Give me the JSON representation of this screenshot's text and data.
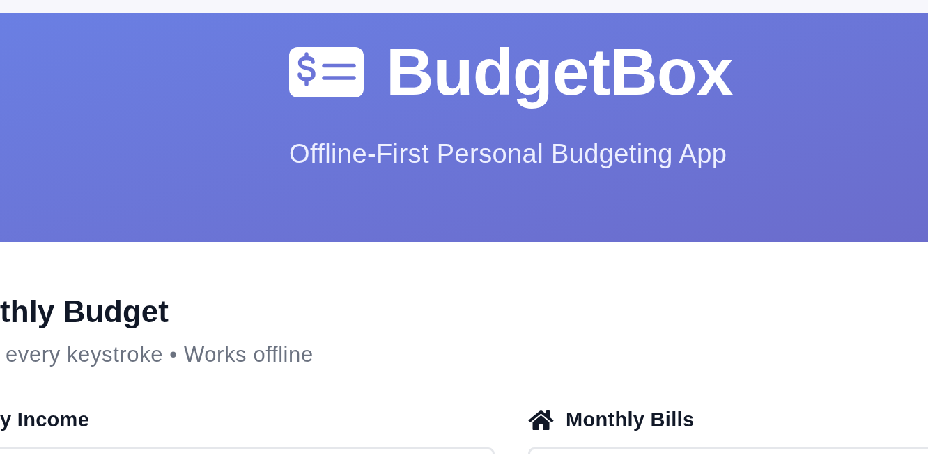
{
  "header": {
    "app_name": "BudgetBox",
    "tagline": "Offline-First Personal Budgeting App"
  },
  "page": {
    "title": "thly Budget",
    "subtitle": "every keystroke • Works offline"
  },
  "sections": [
    {
      "kind": "plain",
      "title": "y Income"
    },
    {
      "kind": "icon",
      "title": "Monthly Bills"
    }
  ]
}
